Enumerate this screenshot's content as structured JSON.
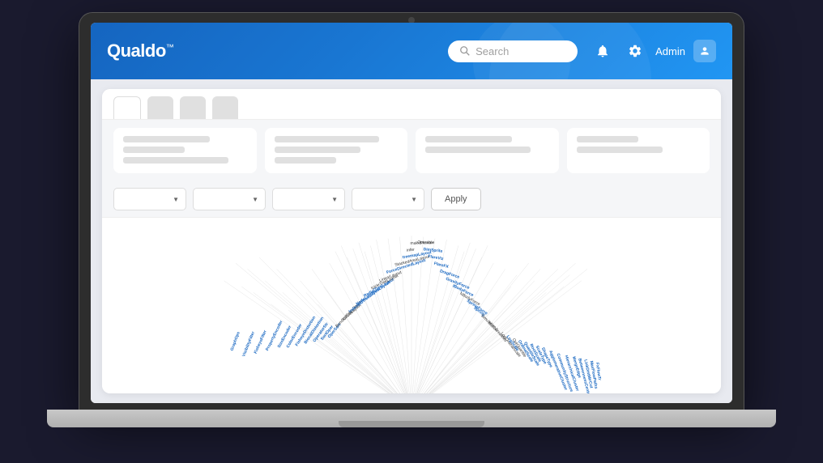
{
  "logo": {
    "text": "Qualdo",
    "tm": "™"
  },
  "header": {
    "search_placeholder": "Search",
    "admin_label": "Admin",
    "nav_items": [
      "",
      "",
      "",
      ""
    ]
  },
  "tabs": [
    {
      "label": "",
      "active": true
    },
    {
      "label": "",
      "active": false
    },
    {
      "label": "",
      "active": false
    },
    {
      "label": "",
      "active": false
    }
  ],
  "summary_cards": [
    {
      "id": 1
    },
    {
      "id": 2
    },
    {
      "id": 3
    },
    {
      "id": 4
    }
  ],
  "filters": [
    {
      "id": 1
    },
    {
      "id": 2
    },
    {
      "id": 3
    },
    {
      "id": 4
    }
  ],
  "apply_button": "Apply",
  "visualization": {
    "nodes_blue": [
      "GraphOps",
      "VisibilityFilter",
      "FisheyeFilter",
      "PropertyEncoder",
      "SizeEncoder",
      "ColorEncoder",
      "FisheyeDistortion",
      "BiocalDistortion",
      "OperatorStr",
      "SortOper",
      "OperSort",
      "BundledEdgeRouter",
      "CircleLayout",
      "IndentedTreeLayout",
      "NodeLinkTreeLayout",
      "RadialTreeLayout",
      "IcicleTreeLayout",
      "LinearLayout",
      "ForceDirectedLayout",
      "StackedAreaLayout",
      "treemapLayout",
      "DimSprite",
      "FlareViz",
      "FlareFX",
      "DragForce",
      "GravityForce",
      "IBodyForce",
      "NBodyForce",
      "SpringForce",
      "Spring",
      "Simulation",
      "Motion",
      "LogScale",
      "OrdinalScale",
      "QuantileScale",
      "RootScale",
      "ScaleType",
      "ShapeType",
      "AgglomerativeCluster",
      "CommunityStructure",
      "HierarchicalCluster",
      "MergeEdge",
      "BetweennessCentrality",
      "LinkDistMirCut",
      "MaxFlowPaths",
      "FxFlowTr"
    ],
    "nodes_dark": [
      "SpaceAnalyzer",
      "RandomAnalyzer",
      "BifocalDistortionAnalyzer",
      "infer",
      "makeFlexible",
      "Operator",
      "FlareUtils",
      "BreakMo",
      "LogOrdinalScale",
      "OutQuantile",
      "BetwCen",
      "LinkDist"
    ]
  }
}
